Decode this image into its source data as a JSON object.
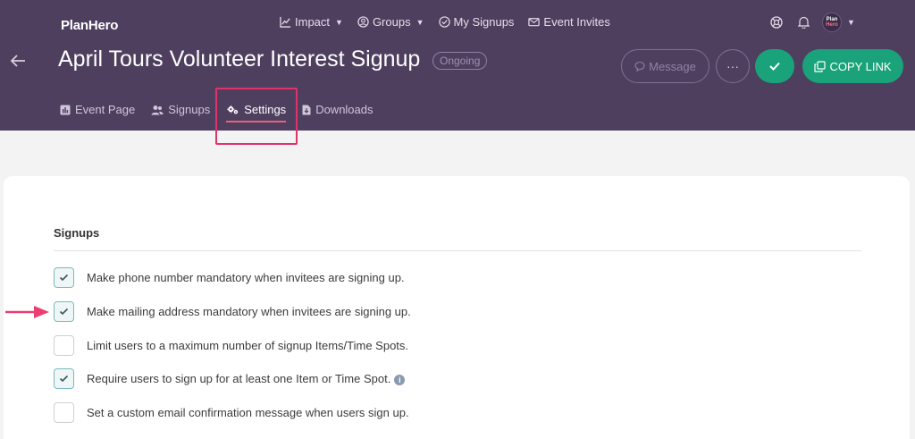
{
  "brand": {
    "logo": "PlanHero",
    "avatar_line1": "Plan",
    "avatar_line2": "Hero"
  },
  "topnav": [
    {
      "label": "Impact",
      "icon": "chart-line-icon",
      "dropdown": true
    },
    {
      "label": "Groups",
      "icon": "user-circle-icon",
      "dropdown": true
    },
    {
      "label": "My Signups",
      "icon": "check-circle-icon",
      "dropdown": false
    },
    {
      "label": "Event Invites",
      "icon": "envelope-icon",
      "dropdown": false
    }
  ],
  "event": {
    "title": "April Tours Volunteer Interest Signup",
    "status": "Ongoing"
  },
  "actions": {
    "message_label": "Message",
    "more_label": "···",
    "copy_label": "COPY LINK"
  },
  "tabs": [
    {
      "label": "Event Page",
      "icon": "bar-chart-icon",
      "active": false
    },
    {
      "label": "Signups",
      "icon": "users-icon",
      "active": false
    },
    {
      "label": "Settings",
      "icon": "gears-icon",
      "active": true
    },
    {
      "label": "Downloads",
      "icon": "file-download-icon",
      "active": false
    }
  ],
  "settings": {
    "section_title": "Signups",
    "options": [
      {
        "label": "Make phone number mandatory when invitees are signing up.",
        "checked": true,
        "info": false
      },
      {
        "label": "Make mailing address mandatory when invitees are signing up.",
        "checked": true,
        "info": false
      },
      {
        "label": "Limit users to a maximum number of signup Items/Time Spots.",
        "checked": false,
        "info": false
      },
      {
        "label": "Require users to sign up for at least one Item or Time Spot.",
        "checked": true,
        "info": true
      },
      {
        "label": "Set a custom email confirmation message when users sign up.",
        "checked": false,
        "info": false
      }
    ]
  },
  "colors": {
    "header": "#4e3f5f",
    "accent_green": "#1aa37a",
    "highlight": "#e0336a",
    "tab_underline": "#e8617d"
  }
}
